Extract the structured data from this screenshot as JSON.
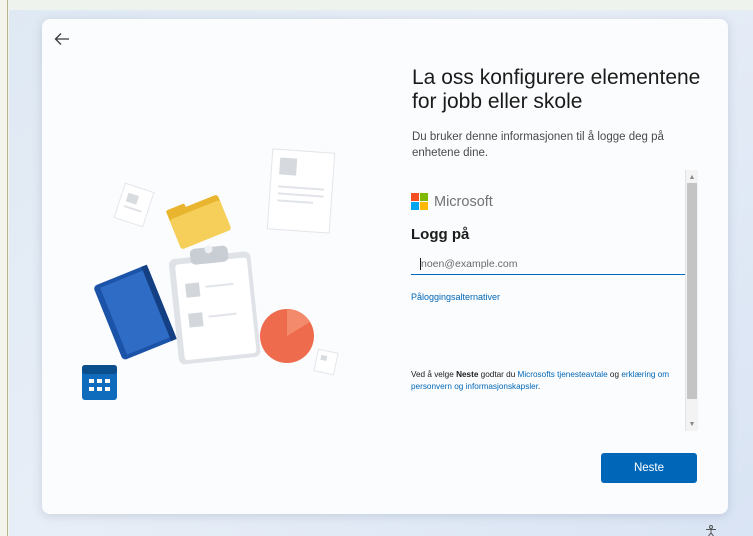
{
  "window": {
    "back_icon": "back-arrow-icon"
  },
  "heading": {
    "title_line1": "La oss konfigurere elementene",
    "title_line2": "for jobb eller skole",
    "description": "Du bruker denne informasjonen til å logge deg på enhetene dine."
  },
  "signin": {
    "brand": "Microsoft",
    "brand_colors": [
      "#f25022",
      "#7fba00",
      "#00a4ef",
      "#ffb900"
    ],
    "heading": "Logg på",
    "email_placeholder": "noen@example.com",
    "email_value": "",
    "options_link": "Påloggingsalternativer",
    "terms": {
      "prefix": "Ved å velge ",
      "bold": "Neste",
      "mid": " godtar du ",
      "link1": "Microsofts tjenesteavtale",
      "and": " og ",
      "link2": "erklæring om personvern og informasjonskapsler",
      "suffix": "."
    }
  },
  "footer": {
    "next_label": "Neste",
    "accessibility_icon": "accessibility-icon"
  },
  "colors": {
    "accent": "#0067b8",
    "card_bg": "#fbfcfd"
  }
}
